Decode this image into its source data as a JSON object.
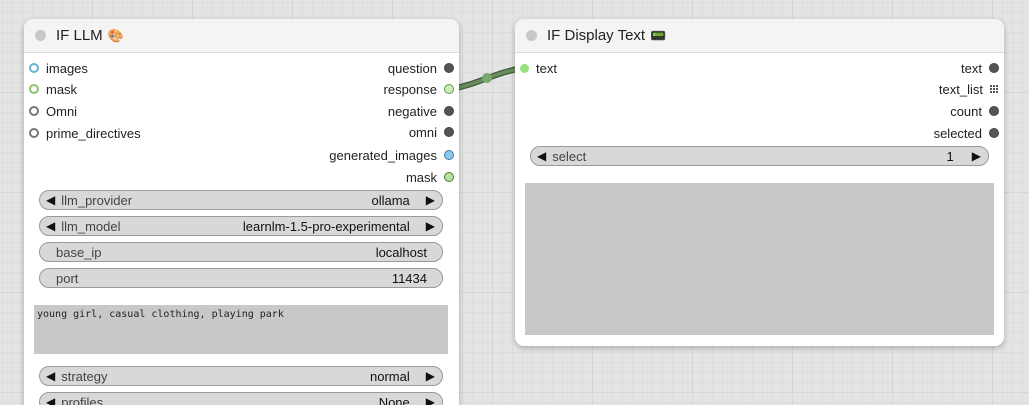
{
  "colors": {
    "link": "#5a7a50",
    "canvas": "#e4e4e4"
  },
  "llm_node": {
    "title": "IF LLM",
    "title_icon": "palette-emoji",
    "inputs": [
      {
        "label": "images",
        "color": "#6ab0d4"
      },
      {
        "label": "mask",
        "color": "#8bc46a"
      },
      {
        "label": "Omni",
        "color": "#777777"
      },
      {
        "label": "prime_directives",
        "color": "#777777"
      }
    ],
    "outputs": [
      {
        "label": "question"
      },
      {
        "label": "response"
      },
      {
        "label": "negative"
      },
      {
        "label": "omni"
      },
      {
        "label": "generated_images"
      },
      {
        "label": "mask"
      }
    ],
    "widgets": [
      {
        "label": "llm_provider",
        "value": "ollama"
      },
      {
        "label": "llm_model",
        "value": "learnlm-1.5-pro-experimental"
      },
      {
        "label": "base_ip",
        "value": "localhost"
      },
      {
        "label": "port",
        "value": "11434"
      }
    ],
    "prompt_text": "young girl, casual clothing, playing park",
    "widgets_bottom": [
      {
        "label": "strategy",
        "value": "normal"
      },
      {
        "label": "profiles",
        "value": "None"
      }
    ]
  },
  "display_node": {
    "title": "IF Display Text",
    "title_icon": "terminal-emoji",
    "inputs": [
      {
        "label": "text"
      }
    ],
    "outputs": [
      {
        "label": "text"
      },
      {
        "label": "text_list"
      },
      {
        "label": "count"
      },
      {
        "label": "selected"
      }
    ],
    "select": {
      "label": "select",
      "value": "1"
    }
  }
}
